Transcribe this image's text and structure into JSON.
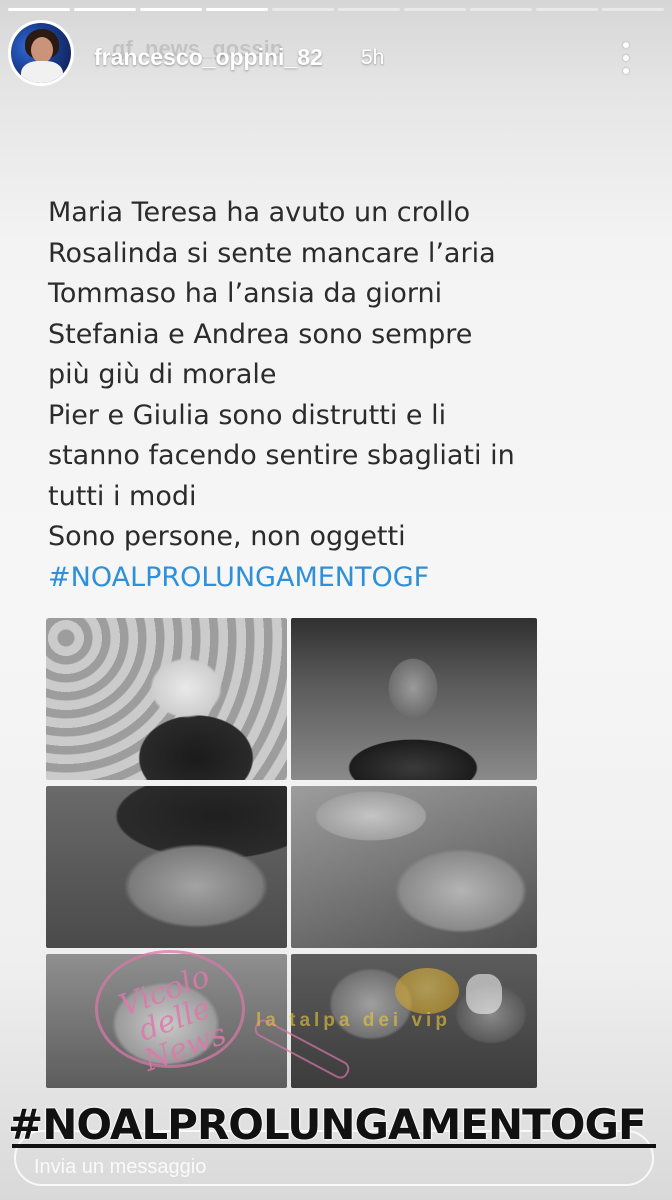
{
  "story": {
    "progress": [
      {
        "fill": 1
      },
      {
        "fill": 1
      },
      {
        "fill": 1
      },
      {
        "fill": 1
      },
      {
        "fill": 0
      },
      {
        "fill": 0
      },
      {
        "fill": 0
      },
      {
        "fill": 0
      },
      {
        "fill": 0
      },
      {
        "fill": 0
      }
    ]
  },
  "header": {
    "username": "francesco_oppini_82",
    "background_username": "gf_news_gossip",
    "time": "5h"
  },
  "post": {
    "lines": [
      "Maria Teresa ha avuto un crollo",
      "Rosalinda si sente mancare l’aria",
      "Tommaso ha l’ansia da giorni",
      "Stefania e Andrea sono sempre",
      "più giù di morale",
      "Pier e Giulia sono distrutti e li",
      "stanno facendo sentire sbagliati in",
      "tutti i modi",
      "Sono persone, non oggetti"
    ],
    "hashtag": "#NOALPROLUNGAMENTOGF"
  },
  "watermarks": {
    "vicolo": "Vicolo delle News",
    "talpa": "la talpa dei vip"
  },
  "sticker": {
    "hashtag": "#NOALPROLUNGAMENTOGF"
  },
  "reply": {
    "placeholder": "Invia un messaggio"
  }
}
